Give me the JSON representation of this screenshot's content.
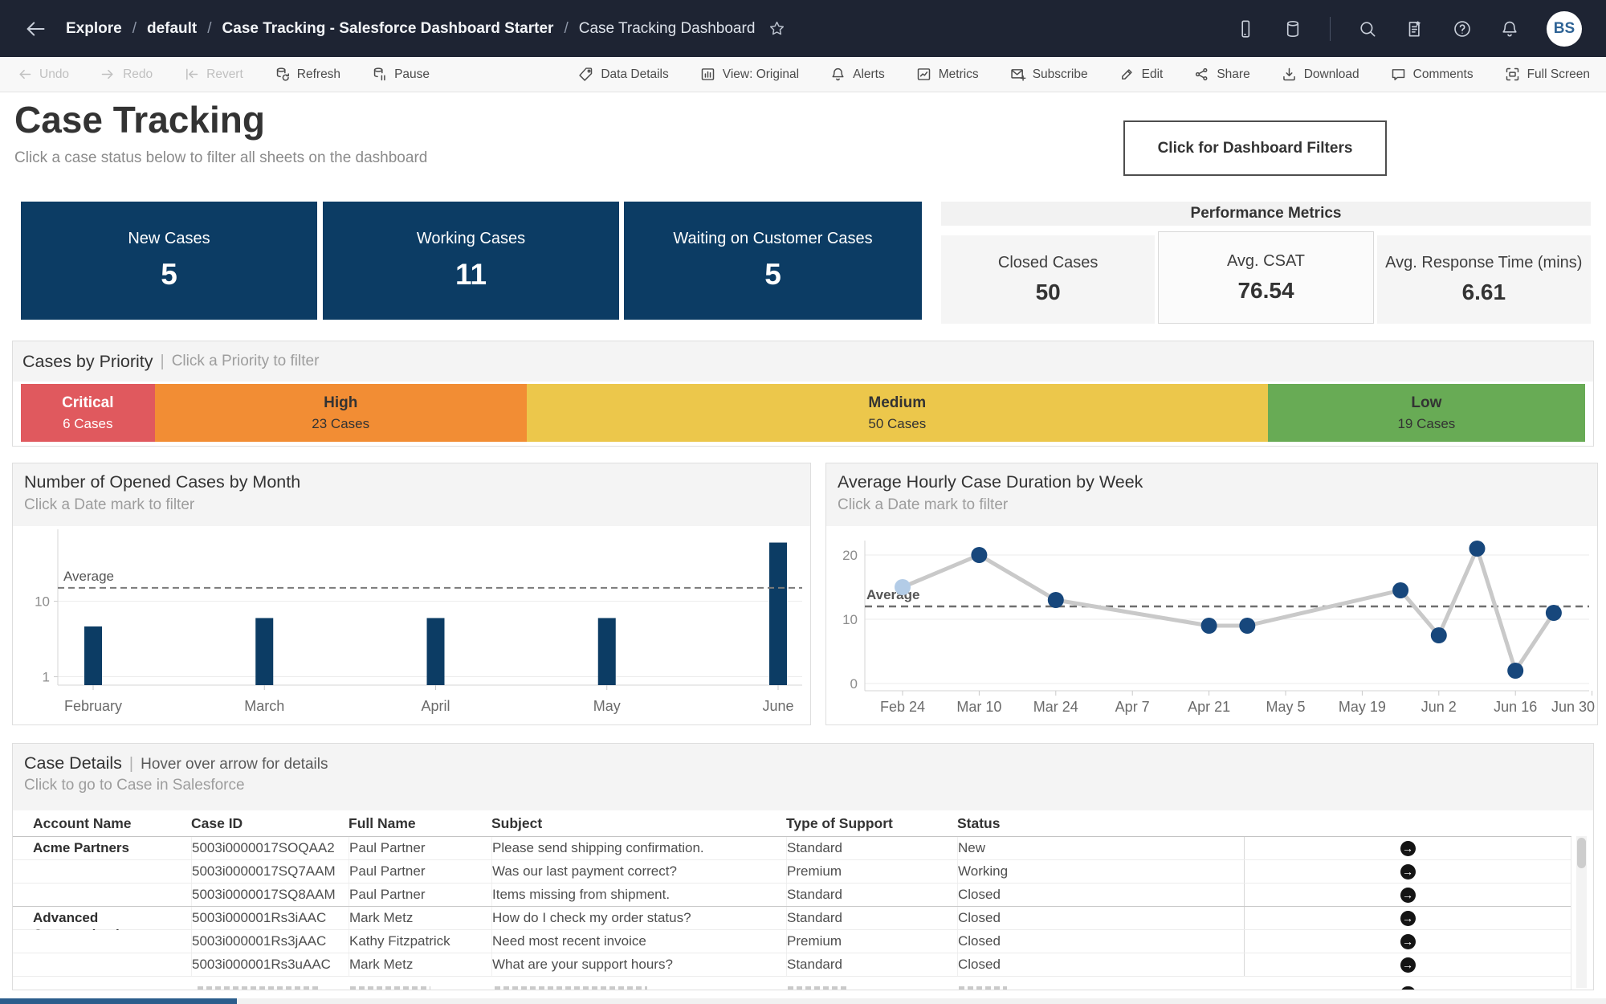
{
  "topbar": {
    "breadcrumb": [
      "Explore",
      "default",
      "Case Tracking - Salesforce Dashboard Starter",
      "Case Tracking Dashboard"
    ],
    "avatar": "BS",
    "right_icons": [
      "mobile",
      "database",
      "divider",
      "search",
      "favorites",
      "help",
      "notifications"
    ]
  },
  "toolbar": {
    "left": [
      {
        "label": "Undo",
        "icon": "undo",
        "disabled": true
      },
      {
        "label": "Redo",
        "icon": "redo",
        "disabled": true
      },
      {
        "label": "Revert",
        "icon": "revert",
        "disabled": true
      },
      {
        "label": "Refresh",
        "icon": "refresh",
        "disabled": false
      },
      {
        "label": "Pause",
        "icon": "pause",
        "disabled": false
      }
    ],
    "right": [
      {
        "label": "Data Details",
        "icon": "data-details"
      },
      {
        "label": "View: Original",
        "icon": "view"
      },
      {
        "label": "Alerts",
        "icon": "alerts"
      },
      {
        "label": "Metrics",
        "icon": "metrics"
      },
      {
        "label": "Subscribe",
        "icon": "subscribe"
      },
      {
        "label": "Edit",
        "icon": "edit"
      },
      {
        "label": "Share",
        "icon": "share"
      },
      {
        "label": "Download",
        "icon": "download"
      },
      {
        "label": "Comments",
        "icon": "comments"
      },
      {
        "label": "Full Screen",
        "icon": "fullscreen"
      }
    ]
  },
  "header": {
    "title": "Case Tracking",
    "subtitle": "Click a case status below to filter all sheets on the dashboard",
    "filters_button": "Click for Dashboard Filters"
  },
  "status_tiles": [
    {
      "label": "New Cases",
      "value": "5"
    },
    {
      "label": "Working Cases",
      "value": "11"
    },
    {
      "label": "Waiting on Customer Cases",
      "value": "5"
    }
  ],
  "performance": {
    "title": "Performance Metrics",
    "metrics": [
      {
        "label": "Closed Cases",
        "value": "50",
        "boxed": false
      },
      {
        "label": "Avg. CSAT",
        "value": "76.54",
        "boxed": true
      },
      {
        "label": "Avg. Response Time (mins)",
        "value": "6.61",
        "boxed": false
      }
    ]
  },
  "priority": {
    "title": "Cases by Priority",
    "hint": "Click a Priority to filter",
    "segments": [
      {
        "name": "Critical",
        "cases": 6,
        "label": "6 Cases",
        "color": "#E0595E",
        "text_color": "#FFFFFF"
      },
      {
        "name": "High",
        "cases": 23,
        "label": "23 Cases",
        "color": "#F28D34",
        "text_color": "#333333"
      },
      {
        "name": "Medium",
        "cases": 50,
        "label": "50 Cases",
        "color": "#ECC74B",
        "text_color": "#333333"
      },
      {
        "name": "Low",
        "cases": 19,
        "label": "19 Cases",
        "color": "#68AB55",
        "text_color": "#333333"
      }
    ]
  },
  "chart_data": [
    {
      "type": "bar",
      "title": "Number of Opened Cases by Month",
      "subtitle": "Click a Date mark to filter",
      "categories": [
        "February",
        "March",
        "April",
        "May",
        "June"
      ],
      "values": [
        7,
        8,
        8,
        8,
        17
      ],
      "average": 11.6,
      "average_label": "Average",
      "yticks": [
        1,
        10
      ],
      "ylim": [
        0,
        19
      ],
      "bar_color": "#0C3C64",
      "grid": "horizontal-light"
    },
    {
      "type": "line",
      "title": "Average Hourly Case Duration by Week",
      "subtitle": "Click a Date mark to filter",
      "x_tick_labels": [
        "Feb 24",
        "Mar 10",
        "Mar 24",
        "Apr 7",
        "Apr 21",
        "May 5",
        "May 19",
        "Jun 2",
        "Jun 16",
        "Jun 30"
      ],
      "x_tick_weeks": [
        0,
        2,
        4,
        6,
        8,
        10,
        12,
        14,
        16,
        18
      ],
      "points": [
        {
          "week": 0,
          "date": "Feb 24",
          "value": 15,
          "highlight": true
        },
        {
          "week": 2,
          "date": "Mar 10",
          "value": 20,
          "highlight": false
        },
        {
          "week": 4,
          "date": "Mar 24",
          "value": 13,
          "highlight": false
        },
        {
          "week": 8,
          "date": "Apr 21",
          "value": 9,
          "highlight": false
        },
        {
          "week": 9,
          "date": "Apr 28",
          "value": 9,
          "highlight": false
        },
        {
          "week": 13,
          "date": "May 26",
          "value": 14.5,
          "highlight": false
        },
        {
          "week": 14,
          "date": "Jun 2",
          "value": 7.5,
          "highlight": false
        },
        {
          "week": 15,
          "date": "Jun 9",
          "value": 21,
          "highlight": false
        },
        {
          "week": 16,
          "date": "Jun 16",
          "value": 2,
          "highlight": false
        },
        {
          "week": 17,
          "date": "Jun 23",
          "value": 11,
          "highlight": false
        }
      ],
      "average": 12,
      "average_label": "Average",
      "yticks": [
        0,
        10,
        20
      ],
      "ylim": [
        0,
        23
      ],
      "line_color": "#C9C9C9",
      "point_color": "#17477C",
      "highlight_point_color": "#B3CCE7"
    }
  ],
  "case_details": {
    "title": "Case Details",
    "hint": "Hover over arrow for details",
    "subtitle": "Click to go to Case in Salesforce",
    "columns": [
      "Account Name",
      "Case ID",
      "Full Name",
      "Subject",
      "Type of Support",
      "Status"
    ],
    "rows": [
      {
        "account": "Acme Partners",
        "case_id": "5003i0000017SOQAA2",
        "full_name": "Paul Partner",
        "subject": "Please send shipping confirmation.",
        "type": "Standard",
        "status": "New",
        "group_start": false
      },
      {
        "account": "",
        "case_id": "5003i0000017SQ7AAM",
        "full_name": "Paul Partner",
        "subject": "Was our last payment correct?",
        "type": "Premium",
        "status": "Working",
        "group_start": false
      },
      {
        "account": "",
        "case_id": "5003i0000017SQ8AAM",
        "full_name": "Paul Partner",
        "subject": "Items missing from shipment.",
        "type": "Standard",
        "status": "Closed",
        "group_start": false
      },
      {
        "account": "Advanced Communications",
        "case_id": "5003i000001Rs3iAAC",
        "full_name": "Mark Metz",
        "subject": "How do I check my order status?",
        "type": "Standard",
        "status": "Closed",
        "group_start": true
      },
      {
        "account": "",
        "case_id": "5003i000001Rs3jAAC",
        "full_name": "Kathy Fitzpatrick",
        "subject": "Need most recent invoice",
        "type": "Premium",
        "status": "Closed",
        "group_start": false
      },
      {
        "account": "",
        "case_id": "5003i000001Rs3uAAC",
        "full_name": "Mark Metz",
        "subject": "What are your support hours?",
        "type": "Standard",
        "status": "Closed",
        "group_start": false
      }
    ]
  },
  "colors": {
    "navy": "#0C3C64",
    "topbar": "#1E2433",
    "scroll_thumb": "#2B5D8C"
  }
}
